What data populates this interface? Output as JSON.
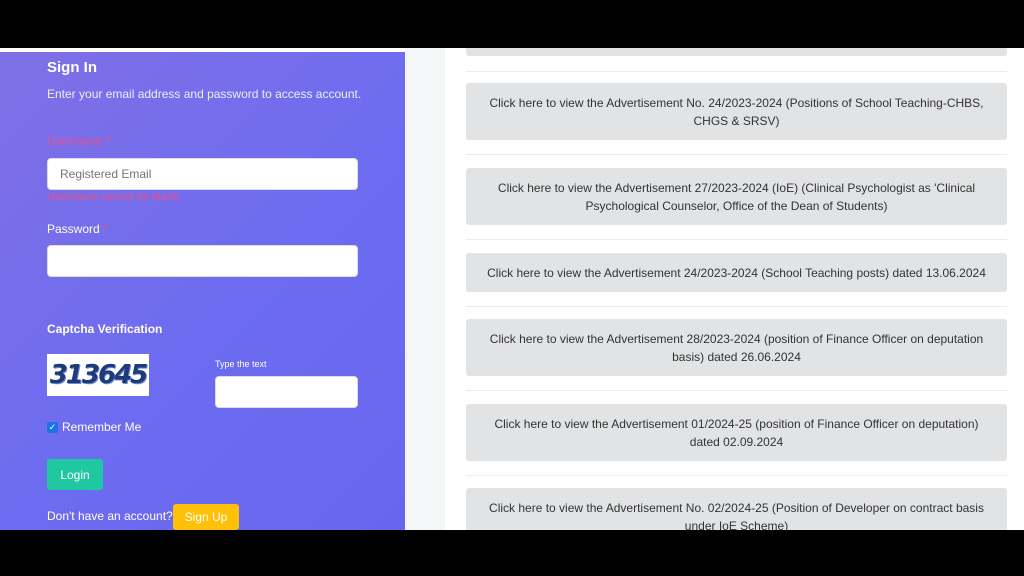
{
  "login": {
    "title": "Sign In",
    "subtitle": "Enter your email address and password to access account.",
    "username_label": "Username",
    "required_mark": "*",
    "username_placeholder": "Registered Email",
    "username_error": "Username cannot be blank.",
    "password_label": "Password",
    "captcha_title": "Captcha Verification",
    "captcha_text": "313645",
    "captcha_input_label": "Type the text",
    "remember_label": "Remember Me",
    "remember_checked": true,
    "login_button": "Login",
    "no_account_text": "Don't have an account?",
    "signup_button": "Sign Up"
  },
  "advertisements": [
    {
      "text": "Click here to view the Advertisement No. 24/2023-2024 (Positions of School Teaching-CHBS, CHGS & SRSV)"
    },
    {
      "text": "Click here to view the Advertisement 27/2023-2024 (IoE) (Clinical Psychologist as 'Clinical Psychological Counselor, Office of the Dean of Students)"
    },
    {
      "text": "Click here to view the Advertisement 24/2023-2024 (School Teaching posts) dated 13.06.2024"
    },
    {
      "text": "Click here to view the Advertisement 28/2023-2024 (position of Finance Officer on deputation basis) dated 26.06.2024"
    },
    {
      "text": "Click here to view the Advertisement 01/2024-25 (position of Finance Officer on deputation) dated 02.09.2024"
    },
    {
      "text": "Click here to view the Advertisement No. 02/2024-25 (Position of Developer on contract basis under IoE Scheme)"
    }
  ],
  "colors": {
    "panel": "#6d6cf0",
    "login_button": "#1fc8a0",
    "signup_button": "#ffc107",
    "error": "#e8508a",
    "ad_background": "#e2e3e5"
  }
}
